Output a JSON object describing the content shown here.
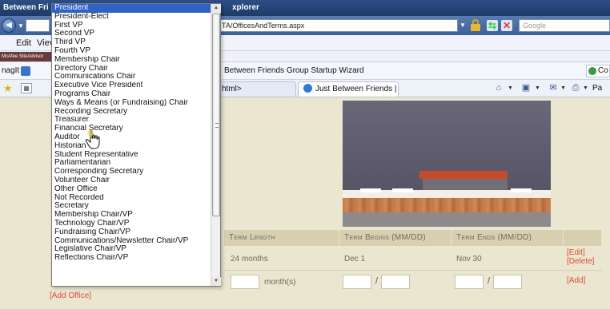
{
  "window": {
    "title_left": "Between Fri",
    "title_right": "xplorer"
  },
  "address_bar": {
    "url": "TA/OfficesAndTerms.aspx"
  },
  "search": {
    "placeholder": "Google"
  },
  "menubar": {
    "items": [
      "Edit",
      "Viev"
    ]
  },
  "mcafee": {
    "label": "McAfee SiteAdvisor"
  },
  "links_bar": {
    "label": "nagIt",
    "item": "Between Friends  Group Startup Wizard",
    "co_label": "Co"
  },
  "tabs": [
    {
      "label": "html>"
    },
    {
      "label": "Just Between Friends | Gro..."
    }
  ],
  "command_bar": {
    "page_label": "Pa"
  },
  "dropdown": {
    "selected": "President",
    "options": [
      "President",
      "President-Elect",
      "First VP",
      "Second VP",
      "Third VP",
      "Fourth VP",
      "Membership Chair",
      "Directory Chair",
      "Communications Chair",
      "Executive Vice President",
      "Programs Chair",
      "Ways & Means (or Fundraising) Chair",
      "Recording Secretary",
      "Treasurer",
      "Financial Secretary",
      "Auditor",
      "Historian",
      "Student Representative",
      "Parliamentarian",
      "Corresponding Secretary",
      "Volunteer Chair",
      "Other Office",
      "Not Recorded",
      "Secretary",
      "Membership Chair/VP",
      "Technology Chair/VP",
      "Fundraising Chair/VP",
      "Communications/Newsletter Chair/VP",
      "Legislative Chair/VP",
      "Reflections Chair/VP"
    ]
  },
  "table": {
    "headers": {
      "term_length": "Term Length",
      "term_begins": "Term Begins (MM/DD)",
      "term_ends": "Term Ends (MM/DD)"
    },
    "row": {
      "term_length": "24 months",
      "term_begins": "Dec 1",
      "term_ends": "Nov 30",
      "edit_link": "[Edit]",
      "delete_link": "[Delete]"
    },
    "new_row": {
      "months_suffix": "month(s)",
      "slash": "/",
      "add_link": "[Add]"
    }
  },
  "add_office_link": "[Add Office]",
  "colors": {
    "page_bg": "#ebe6cf",
    "header_bg": "#d8cfb0",
    "link": "#e04a3a",
    "selection": "#3062c4"
  }
}
